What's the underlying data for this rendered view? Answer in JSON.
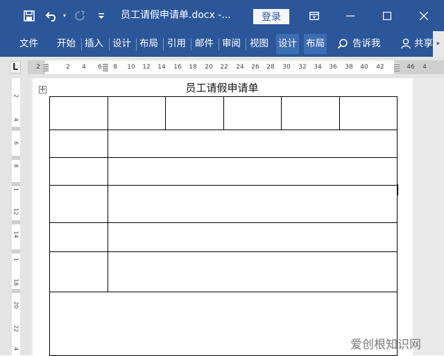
{
  "titlebar": {
    "save_icon": "save-icon",
    "undo_icon": "undo-icon",
    "doc_title": "员工请假申请单.docx  -...",
    "login": "登录",
    "window_controls": [
      "ribbon-display-icon",
      "minimize-icon",
      "maximize-icon",
      "close-icon"
    ]
  },
  "ribbon": {
    "tabs": [
      "文件",
      "开始",
      "插入",
      "设计",
      "布局",
      "引用",
      "邮件",
      "审阅",
      "视图",
      "设计",
      "布局"
    ],
    "tell_me": "告诉我",
    "share": "共享"
  },
  "ruler": {
    "corner": "L",
    "numbers": [
      "2",
      "2",
      "4",
      "6",
      "8",
      "10",
      "12",
      "14",
      "16",
      "18",
      "20",
      "22",
      "24",
      "26",
      "28",
      "30",
      "32",
      "34",
      "36",
      "38",
      "40",
      "42",
      "46",
      "4"
    ],
    "vertical_numbers": [
      "2",
      "4",
      "6",
      "8",
      "1",
      "12",
      "14",
      "1",
      "18",
      "20",
      "22",
      "4"
    ]
  },
  "document": {
    "title": "员工请假申请单",
    "table_rows": 7
  },
  "watermark": "爱创根知识网"
}
